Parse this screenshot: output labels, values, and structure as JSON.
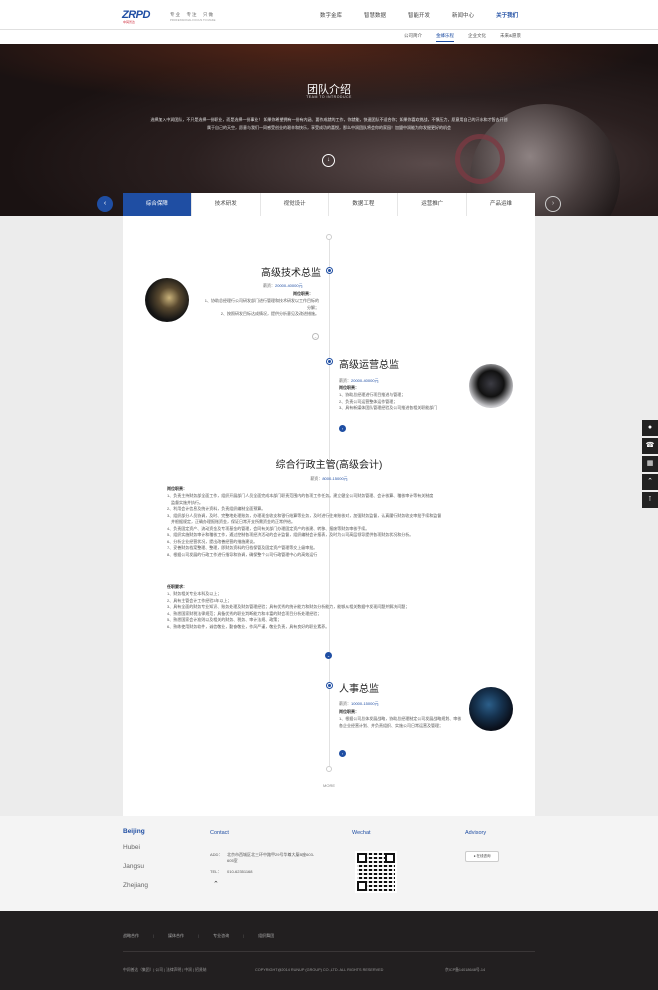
{
  "brand": {
    "logo_text": "ZRPD",
    "logo_sub": "中润普达",
    "slogan": "专业　专注　只做",
    "slogan_en": "PROFESSIONAL FOCUS TO MAKE"
  },
  "nav": [
    "数字金库",
    "智慧数据",
    "智能开发",
    "新闻中心",
    "关于我们"
  ],
  "subnav": [
    "公司简介",
    "金蜂乐程",
    "企业文化",
    "未来&愿景"
  ],
  "banner": {
    "title": "团队介绍",
    "subtitle": "TEAM TO INTRODUCE",
    "text": "选择加入中润团队，不只是选择一份职业，而是选择一份事业！ 如果你希望拥有一份有内涵、要作成就的工作，你就能，快速团队不适合你；如果你喜欢挑战，不惧压力，愿意用自己的汗水和才智去开创属于自己的天空，愿意与我们一同感受创业的艰辛和快乐，享受成功的喜悦，那么中润团队将会你的家园！加盟中润能为你发掘更好的机会"
  },
  "tabs": [
    "综合保障",
    "技术研发",
    "视觉设计",
    "数据工程",
    "运营推广",
    "产品运维"
  ],
  "jobs": [
    {
      "title": "高级技术总监",
      "salary_label": "薪资：",
      "salary": "20000-40000元",
      "duty_head": "岗位职责：",
      "duties": [
        "1、协助总经理行公司研发部门进行管理和技术研发以工作目标的分解；",
        "2、按照研发目标达成情况，提供分析意见及改进措施。"
      ]
    },
    {
      "title": "高级运营总监",
      "salary_label": "薪资：",
      "salary": "20000-40000元",
      "duty_head": "岗位职责：",
      "duties": [
        "1、协助总经理进行项目推进与管理；",
        "2、负责公司运营整体运作管理；",
        "3、具有新媒体团队管理经验及公司推进各相关职能部门"
      ]
    },
    {
      "title": "综合行政主管(高级会计)",
      "salary_label": "薪资：",
      "salary": "8000-15000元",
      "duty_head": "岗位职责：",
      "duties": [
        "1、负责主持财务部全面工作，组织开展部门人员全面完成本部门职责范围内的各项工作任务。建立健全公司财务管理、会计核算、稽核审计等有关制度",
        "　监督实施并执行。",
        "2、利用会计信息及统计资料，负责组织编制全面预算。",
        "3、组织部分人员协调，及时、完整地处理账务，办理现金收支和银行结算等业务，及时进行往来账核对，加强财务监督，认真履行财务收支审批手续和监督",
        "　并根据规定，正确办理报账资金，保证日常开支所需资金的正常供给。",
        "4、负责固定资产、流动资金及专项基金的管理，会同有关部门办理固定资产的核建、转移、报废等财务审核手续。",
        "5、组织实施财务审计和稽核工作，通过控制各项经济活动的会计监督，组织编制会计报表，及时为公司高层领导提供各项财务状况和分析。",
        "6、分析企业经营状况，提出改善经营的措施建议。",
        "7、妥善财务档案整理、整理，即财务资料的归档保管及固定资产管理等交上级审批。",
        "8、根据公司发展的行政工作进行指导和协调，确保整个公司行政管理中心的高效运行"
      ],
      "req_head": "任职要求：",
      "reqs": [
        "1、财务相关专业本科及以上；",
        "2、具有主管会计工作经验3年以上；",
        "3、具有全面的财务专业知识、账务处理及财务管理经验；具有优秀的统计能力和财务分析能力，能够从相关数据中发现问题并解决问题；",
        "4、熟悉国家财税法律规范；具备优秀的职业判断能力和丰富的财会项目分析处理经验；",
        "5、熟悉国家会计准则以及相关的财务、税务、审计法规、政策；",
        "6、熟练使用财务软件，诚信敬业，勤奋敬业，作风严谨，敬业负责，具有良好的职业素养。"
      ]
    },
    {
      "title": "人事总监",
      "salary_label": "薪资：",
      "salary": "10000-15000元",
      "duty_head": "岗位职责：",
      "duties": [
        "1、根据公司总体发展战略，协助总经理制定公司发展战略规划、审核各企业经营计划、并负责组织、实施公司日常运营及管理；"
      ]
    }
  ],
  "more_label": "MORE",
  "footer": {
    "cities": [
      "Beijing",
      "Hubei",
      "Jangsu",
      "Zhejiang"
    ],
    "contact_head": "Contact",
    "address_label": "ADD：",
    "address": "北京市西城区北三环中路甲29号华尊大厦B座603-605室",
    "tel_label": "TEL：",
    "tel": "010-62351168",
    "wechat_head": "Wechat",
    "advisory_head": "Advisory",
    "advisory_btn": "在线咨询"
  },
  "bottom": {
    "links": [
      "战略合作",
      "媒体合作",
      "专业咨询",
      "组织舞团"
    ],
    "left": "中润普达（集团）| 公司 | 法律声明 | 中润 | 招贤纳",
    "copyright": "COPYRIGHT@2014 RUNUP (GROUP) CO.,LTD. ALL RIGHTS RESERVED",
    "icp": "京ICP备14018648号-14"
  },
  "accent_color": "#1f4ea3"
}
